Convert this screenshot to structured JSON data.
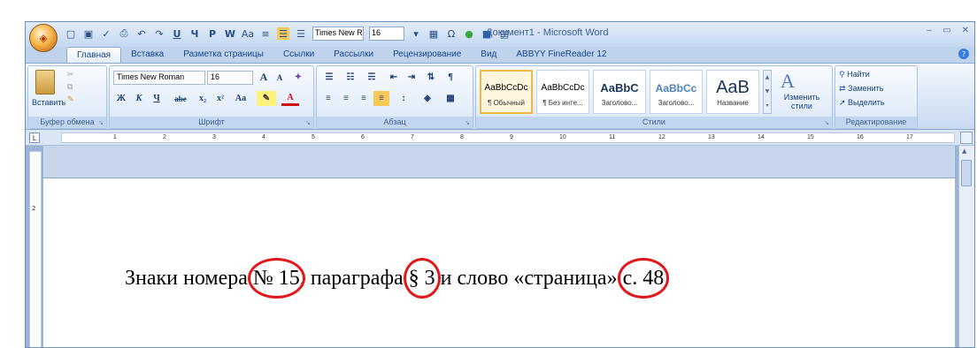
{
  "window": {
    "title": "Документ1 - Microsoft Word",
    "controls": [
      "‒",
      "▭",
      "✕"
    ]
  },
  "quick_access": {
    "font_name": "Times New Ro",
    "font_size": "16",
    "dropdown_glyph": "▾"
  },
  "tabs": [
    "Главная",
    "Вставка",
    "Разметка страницы",
    "Ссылки",
    "Рассылки",
    "Рецензирование",
    "Вид",
    "ABBYY FineReader 12"
  ],
  "help_label": "?",
  "ribbon": {
    "clipboard": {
      "label": "Буфер обмена",
      "paste_label": "Вставить"
    },
    "font": {
      "label": "Шрифт",
      "font_name": "Times New Roman",
      "font_size": "16",
      "buttons": [
        "Ж",
        "К",
        "Ч",
        "abe",
        "x₂",
        "x²",
        "Aa"
      ],
      "grow": "A",
      "shrink": "A"
    },
    "paragraph": {
      "label": "Абзац"
    },
    "styles": {
      "label": "Стили",
      "items": [
        {
          "sample": "AaBbCcDc",
          "name": "¶ Обычный"
        },
        {
          "sample": "AaBbCcDc",
          "name": "¶ Без инте..."
        },
        {
          "sample": "AaBbC",
          "name": "Заголово..."
        },
        {
          "sample": "AaBbCc",
          "name": "Заголово..."
        },
        {
          "sample": "AaB",
          "name": "Название"
        }
      ],
      "change_label": "Изменить стили"
    },
    "editing": {
      "label": "Редактирование",
      "find": "Найти",
      "replace": "Заменить",
      "select": "Выделить"
    }
  },
  "ruler": {
    "numbers": [
      "1",
      "2",
      "3",
      "4",
      "5",
      "6",
      "7",
      "8",
      "9",
      "10",
      "11",
      "12",
      "13",
      "14",
      "15",
      "16",
      "17"
    ],
    "tab_selector": "L"
  },
  "vertical_ruler_mark": "2",
  "document": {
    "part1": "Знаки номера ",
    "num_sign": "№ 15",
    "part2": ", параграфа ",
    "para_sign": "§ 3",
    "part3": " и слово «страница» ",
    "page_sign": "с. 48"
  },
  "colors": {
    "annotation_circle": "#e0181c",
    "ribbon_text": "#15428b"
  }
}
